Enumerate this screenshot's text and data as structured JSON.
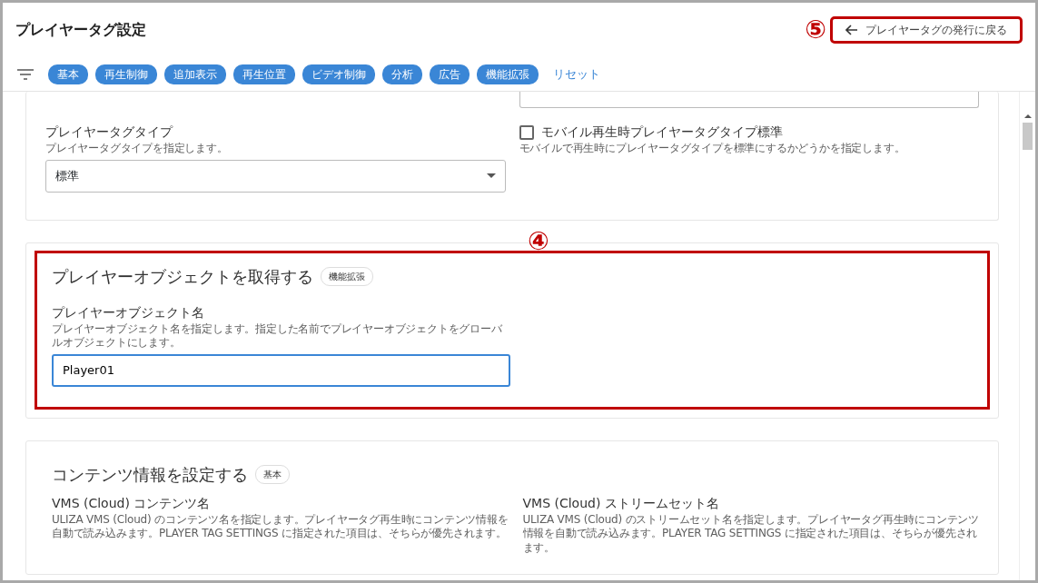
{
  "header": {
    "title": "プレイヤータグ設定",
    "annotation": "⑤",
    "back_button": {
      "label": "プレイヤータグの発行に戻る",
      "highlighted": true
    }
  },
  "filter_chips": [
    {
      "label": "基本"
    },
    {
      "label": "再生制御"
    },
    {
      "label": "追加表示"
    },
    {
      "label": "再生位置"
    },
    {
      "label": "ビデオ制御"
    },
    {
      "label": "分析"
    },
    {
      "label": "広告"
    },
    {
      "label": "機能拡張"
    }
  ],
  "reset_link": "リセット",
  "sections": [
    {
      "fields": [
        {
          "kind": "spacer"
        },
        {
          "kind": "input_stub"
        },
        {
          "kind": "select",
          "label": "プレイヤータグタイプ",
          "description": "プレイヤータグタイプを指定します。",
          "value": "標準"
        },
        {
          "kind": "checkbox",
          "label": "モバイル再生時プレイヤータグタイプ標準",
          "description": "モバイルで再生時にプレイヤータグタイプを標準にするかどうかを指定します。",
          "checked": false
        }
      ]
    },
    {
      "title": "プレイヤーオブジェクトを取得する",
      "tag": "機能拡張",
      "annotation": "④",
      "highlighted": true,
      "fields": [
        {
          "kind": "text",
          "label": "プレイヤーオブジェクト名",
          "description": "プレイヤーオブジェクト名を指定します。指定した名前でプレイヤーオブジェクトをグローバルオブジェクトにします。",
          "value": "Player01",
          "focused": true
        }
      ]
    },
    {
      "title": "コンテンツ情報を設定する",
      "tag": "基本",
      "fields": [
        {
          "kind": "info",
          "label": "VMS (Cloud) コンテンツ名",
          "description": "ULIZA VMS (Cloud) のコンテンツ名を指定します。プレイヤータグ再生時にコンテンツ情報を自動で読み込みます。PLAYER TAG SETTINGS に指定された項目は、そちらが優先されます。"
        },
        {
          "kind": "info",
          "label": "VMS (Cloud) ストリームセット名",
          "description": "ULIZA VMS (Cloud) のストリームセット名を指定します。プレイヤータグ再生時にコンテンツ情報を自動で読み込みます。PLAYER TAG SETTINGS に指定された項目は、そちらが優先されます。"
        }
      ]
    }
  ]
}
